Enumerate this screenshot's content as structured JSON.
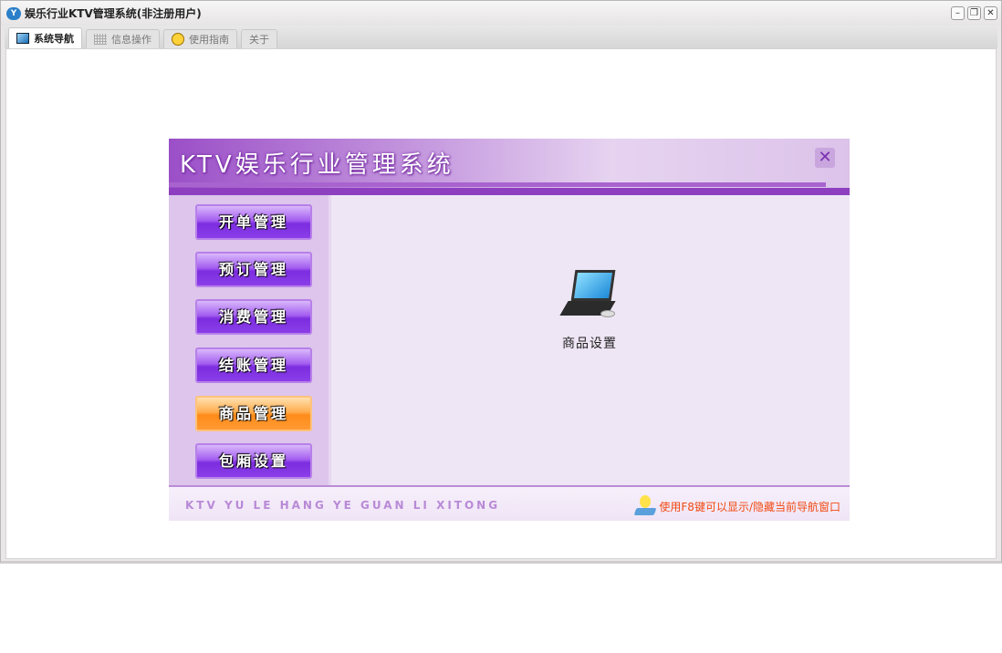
{
  "window": {
    "title": "娱乐行业KTV管理系统(非注册用户)",
    "controls": [
      "minimize",
      "restore",
      "close"
    ]
  },
  "tabs": [
    {
      "label": "系统导航",
      "icon": "monitor-icon",
      "active": true
    },
    {
      "label": "信息操作",
      "icon": "grid-icon"
    },
    {
      "label": "使用指南",
      "icon": "help-icon"
    },
    {
      "label": "关于"
    }
  ],
  "panel": {
    "title": "KTV娱乐行业管理系统",
    "menu": [
      {
        "label": "开单管理"
      },
      {
        "label": "预订管理"
      },
      {
        "label": "消费管理"
      },
      {
        "label": "结账管理"
      },
      {
        "label": "商品管理",
        "selected": true
      },
      {
        "label": "包厢设置"
      }
    ],
    "items": [
      {
        "label": "商品设置",
        "icon": "laptop-icon"
      }
    ],
    "footer": {
      "pinyin": "KTV YU LE HANG YE GUAN LI XITONG",
      "tip": "使用F8键可以显示/隐藏当前导航窗口"
    }
  },
  "colors": {
    "accent": "#8e3fbf",
    "selected": "#ff8c1a",
    "tip": "#f24a12"
  }
}
